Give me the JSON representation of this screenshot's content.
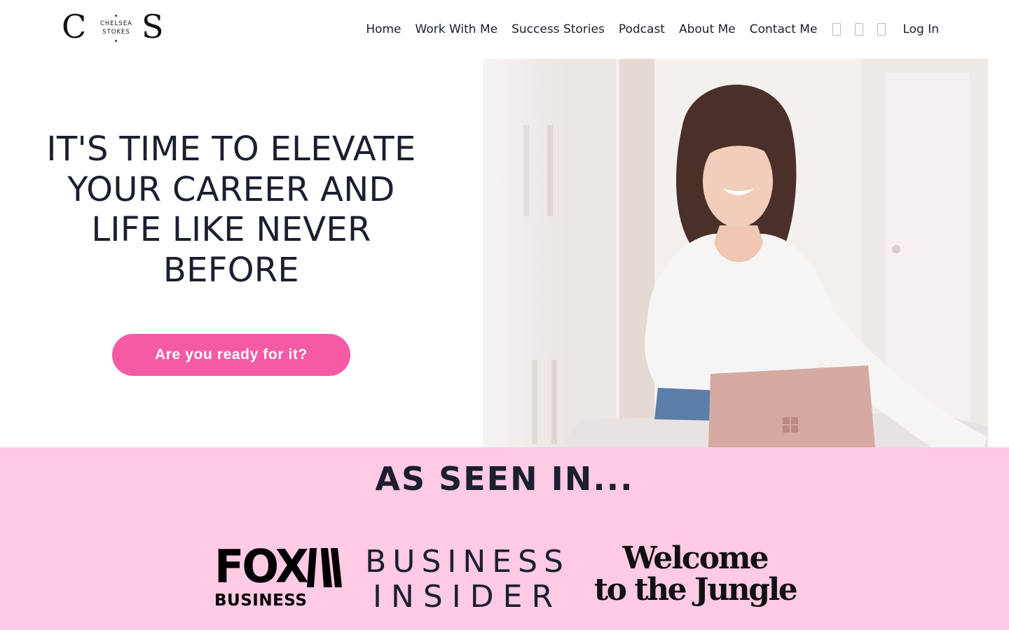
{
  "logo": {
    "letter_left": "C",
    "line1": "CHELSEA",
    "line2": "STOKES",
    "letter_right": "S",
    "star": "✦"
  },
  "nav": {
    "items": [
      {
        "label": "Home"
      },
      {
        "label": "Work With Me"
      },
      {
        "label": "Success Stories"
      },
      {
        "label": "Podcast"
      },
      {
        "label": "About Me"
      },
      {
        "label": "Contact Me"
      }
    ],
    "icons": [
      "social-icon-1",
      "social-icon-2",
      "social-icon-3"
    ],
    "login_label": "Log In"
  },
  "hero": {
    "heading": "IT'S TIME TO ELEVATE YOUR CAREER AND LIFE LIKE NEVER BEFORE",
    "cta_label": "Are you ready for it?",
    "cta_color": "#f55aa5"
  },
  "seen_in": {
    "title": "AS SEEN IN...",
    "background": "#fecae4",
    "logos": {
      "fox_main": "FOX",
      "fox_sub": "BUSINESS",
      "bi_line1": "BUSINESS",
      "bi_line2": "INSIDER",
      "wttj_line1": "Welcome",
      "wttj_line2": "to the Jungle"
    }
  }
}
